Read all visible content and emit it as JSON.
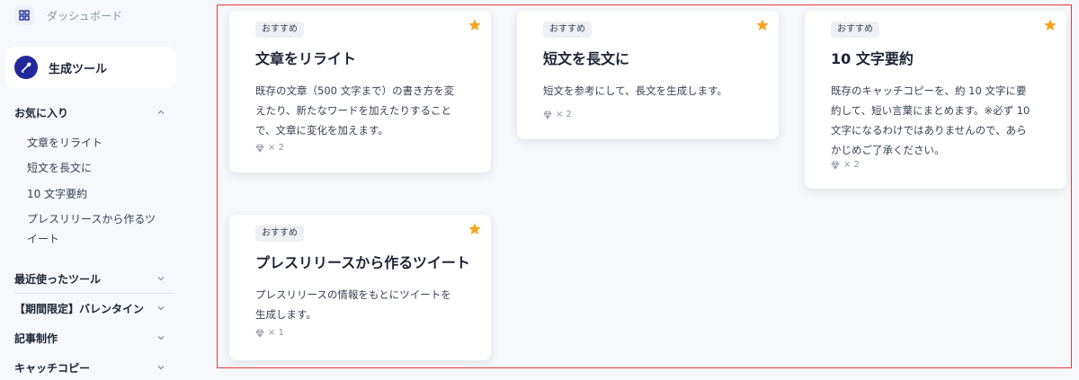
{
  "sidebar": {
    "dashboard_label": "ダッシュボード",
    "generate_tool_label": "生成ツール",
    "favorites": {
      "label": "お気に入り",
      "items": [
        "文章をリライト",
        "短文を長文に",
        "10 文字要約",
        "プレスリリースから作るツ",
        "イート"
      ]
    },
    "sections": [
      "最近使ったツール",
      "【期間限定】バレンタイン",
      "記事制作",
      "キャッチコピー"
    ]
  },
  "cards": [
    {
      "badge": "おすすめ",
      "title": "文章をリライト",
      "desc_lines": [
        "既存の文章（500 文字まで）の書き方を変",
        "えたり、新たなワードを加えたりすること",
        "で、文章に変化を加えます。"
      ],
      "cost": "× 2",
      "starred": true
    },
    {
      "badge": "おすすめ",
      "title": "短文を長文に",
      "desc_lines": [
        "短文を参考にして、長文を生成します。"
      ],
      "cost": "× 2",
      "starred": true
    },
    {
      "badge": "おすすめ",
      "title": "10 文字要約",
      "desc_lines": [
        "既存のキャッチコピーを、約 10 文字に要",
        "約して、短い言葉にまとめます。※必ず 10",
        "文字になるわけではありませんので、あら",
        "かじめご了承ください。"
      ],
      "cost": "× 2",
      "starred": true
    },
    {
      "badge": "おすすめ",
      "title": "プレスリリースから作るツイート",
      "desc_lines": [
        "プレスリリースの情報をもとにツイートを",
        "生成します。"
      ],
      "cost": "× 1",
      "starred": true
    }
  ],
  "colors": {
    "accent": "#22289a",
    "star": "#f5a623",
    "highlight_border": "#e23b3b",
    "background": "#f6f8fb"
  },
  "icons": {
    "dashboard": "grid-icon",
    "generate": "wrench-icon",
    "favorite": "star-icon",
    "cost": "diamond-icon",
    "expand": "chevron-icon"
  }
}
